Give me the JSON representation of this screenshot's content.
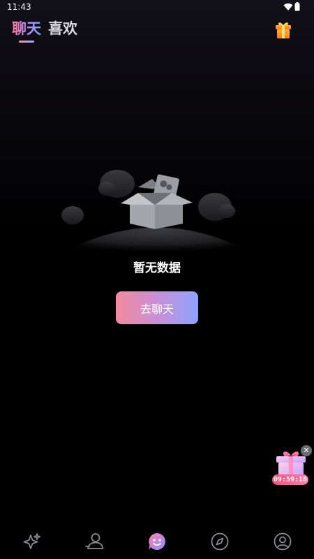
{
  "status_bar": {
    "time": "11:43"
  },
  "header": {
    "tabs": [
      {
        "label": "聊天",
        "active": true
      },
      {
        "label": "喜欢",
        "active": false
      }
    ]
  },
  "empty_state": {
    "message": "暂无数据",
    "button_label": "去聊天"
  },
  "floating_gift": {
    "countdown": "09:59:18"
  },
  "bottom_nav": {
    "items": [
      {
        "icon": "sparkle-icon",
        "active": false
      },
      {
        "icon": "people-icon",
        "active": false
      },
      {
        "icon": "chat-smile-icon",
        "active": true
      },
      {
        "icon": "compass-icon",
        "active": false
      },
      {
        "icon": "profile-icon",
        "active": false
      }
    ]
  },
  "colors": {
    "accent_gradient_start": "#f48a9d",
    "accent_gradient_end": "#8ea3ff",
    "timer_badge": "#ff4f7f",
    "background": "#000000"
  }
}
